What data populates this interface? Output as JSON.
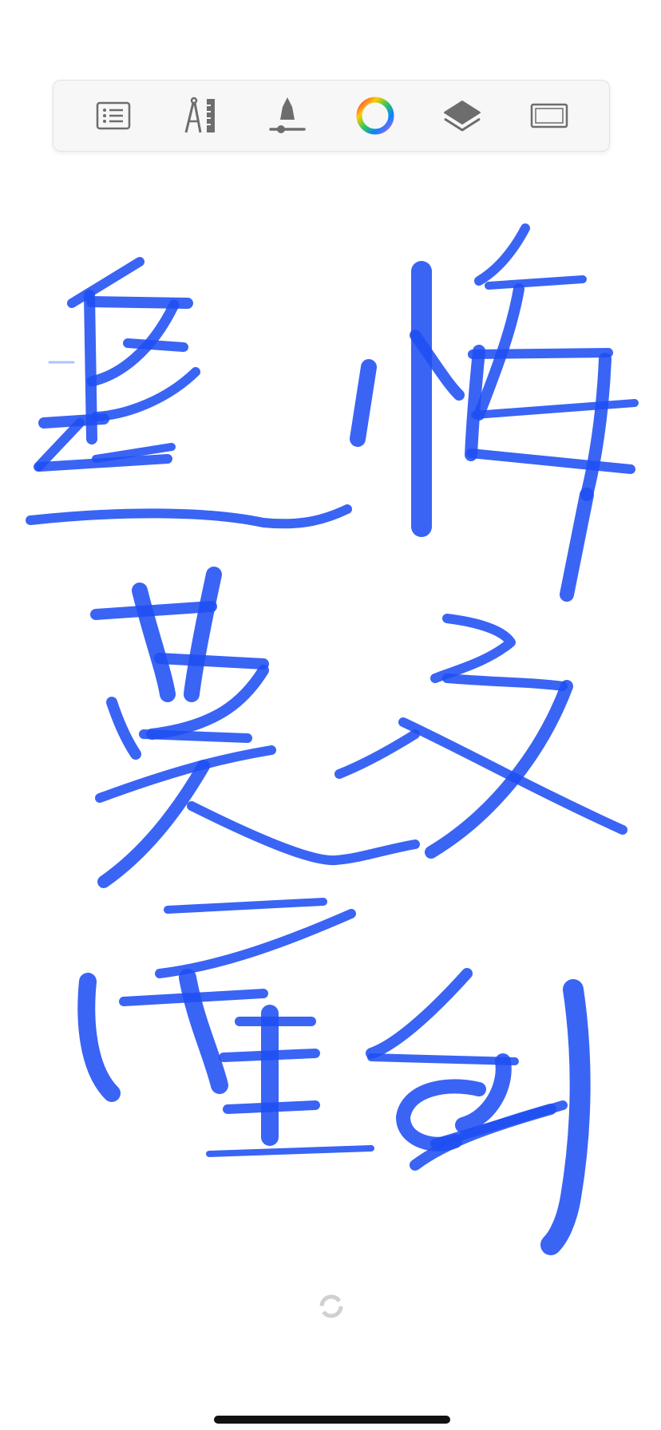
{
  "toolbar": {
    "tools": [
      {
        "icon": "list-icon"
      },
      {
        "icon": "compass-ruler-icon"
      },
      {
        "icon": "brush-size-slider-icon"
      },
      {
        "icon": "color-wheel-icon"
      },
      {
        "icon": "layers-icon"
      },
      {
        "icon": "canvas-frame-icon"
      }
    ]
  },
  "ink": {
    "color": "#1f4ff2"
  },
  "colors": {
    "toolbar_bg": "#f7f7f7",
    "icon_gray": "#6d6d6d",
    "background": "#ffffff"
  }
}
